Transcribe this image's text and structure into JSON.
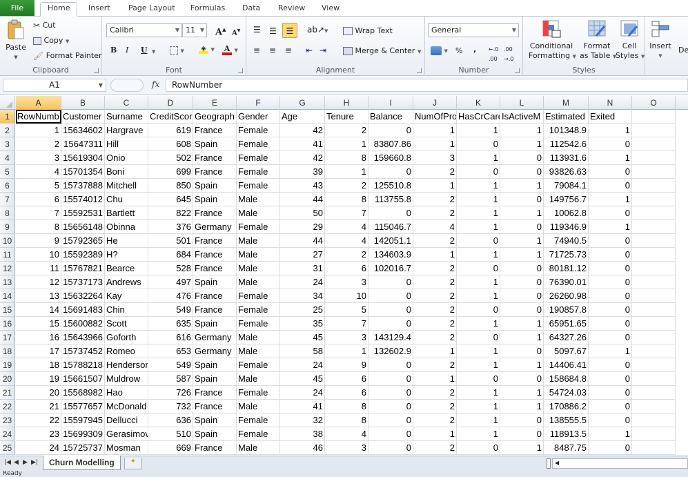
{
  "ribbon_tabs": [
    "File",
    "Home",
    "Insert",
    "Page Layout",
    "Formulas",
    "Data",
    "Review",
    "View"
  ],
  "active_tab": "Home",
  "clipboard": {
    "paste": "Paste",
    "cut": "Cut",
    "copy": "Copy",
    "format_painter": "Format Painter",
    "label": "Clipboard"
  },
  "font": {
    "name": "Calibri",
    "size": "11",
    "label": "Font",
    "bold": "B",
    "italic": "I",
    "underline": "U",
    "grow": "A",
    "shrink": "A"
  },
  "alignment": {
    "wrap_text": "Wrap Text",
    "merge_center": "Merge & Center",
    "label": "Alignment"
  },
  "number": {
    "format": "General",
    "percent": "%",
    "comma": ",",
    "inc_decimal": ".0→.00",
    "dec_decimal": ".00→.0",
    "label": "Number"
  },
  "styles": {
    "conditional": "Conditional",
    "conditional2": "Formatting",
    "format_table": "Format",
    "format_table2": "as Table",
    "cell_styles": "Cell",
    "cell_styles2": "Styles",
    "label": "Styles"
  },
  "cells": {
    "insert": "Insert",
    "delete": "De"
  },
  "formula_bar": {
    "name_box": "A1",
    "fx": "fx",
    "content": "RowNumber"
  },
  "columns": [
    "A",
    "B",
    "C",
    "D",
    "E",
    "F",
    "G",
    "H",
    "I",
    "J",
    "K",
    "L",
    "M",
    "N",
    "O"
  ],
  "header_row": [
    "RowNumber",
    "CustomerId",
    "Surname",
    "CreditScore",
    "Geography",
    "Gender",
    "Age",
    "Tenure",
    "Balance",
    "NumOfProducts",
    "HasCrCard",
    "IsActiveMember",
    "EstimatedSalary",
    "Exited",
    ""
  ],
  "header_display": [
    "RowNumb",
    "Customer",
    "Surname",
    "CreditScor",
    "Geograph",
    "Gender",
    "Age",
    "Tenure",
    "Balance",
    "NumOfPro",
    "HasCrCard",
    "IsActiveM",
    "Estimated",
    "Exited",
    ""
  ],
  "rows": [
    [
      "1",
      "15634602",
      "Hargrave",
      "619",
      "France",
      "Female",
      "42",
      "2",
      "0",
      "1",
      "1",
      "1",
      "101348.9",
      "1"
    ],
    [
      "2",
      "15647311",
      "Hill",
      "608",
      "Spain",
      "Female",
      "41",
      "1",
      "83807.86",
      "1",
      "0",
      "1",
      "112542.6",
      "0"
    ],
    [
      "3",
      "15619304",
      "Onio",
      "502",
      "France",
      "Female",
      "42",
      "8",
      "159660.8",
      "3",
      "1",
      "0",
      "113931.6",
      "1"
    ],
    [
      "4",
      "15701354",
      "Boni",
      "699",
      "France",
      "Female",
      "39",
      "1",
      "0",
      "2",
      "0",
      "0",
      "93826.63",
      "0"
    ],
    [
      "5",
      "15737888",
      "Mitchell",
      "850",
      "Spain",
      "Female",
      "43",
      "2",
      "125510.8",
      "1",
      "1",
      "1",
      "79084.1",
      "0"
    ],
    [
      "6",
      "15574012",
      "Chu",
      "645",
      "Spain",
      "Male",
      "44",
      "8",
      "113755.8",
      "2",
      "1",
      "0",
      "149756.7",
      "1"
    ],
    [
      "7",
      "15592531",
      "Bartlett",
      "822",
      "France",
      "Male",
      "50",
      "7",
      "0",
      "2",
      "1",
      "1",
      "10062.8",
      "0"
    ],
    [
      "8",
      "15656148",
      "Obinna",
      "376",
      "Germany",
      "Female",
      "29",
      "4",
      "115046.7",
      "4",
      "1",
      "0",
      "119346.9",
      "1"
    ],
    [
      "9",
      "15792365",
      "He",
      "501",
      "France",
      "Male",
      "44",
      "4",
      "142051.1",
      "2",
      "0",
      "1",
      "74940.5",
      "0"
    ],
    [
      "10",
      "15592389",
      "H?",
      "684",
      "France",
      "Male",
      "27",
      "2",
      "134603.9",
      "1",
      "1",
      "1",
      "71725.73",
      "0"
    ],
    [
      "11",
      "15767821",
      "Bearce",
      "528",
      "France",
      "Male",
      "31",
      "6",
      "102016.7",
      "2",
      "0",
      "0",
      "80181.12",
      "0"
    ],
    [
      "12",
      "15737173",
      "Andrews",
      "497",
      "Spain",
      "Male",
      "24",
      "3",
      "0",
      "2",
      "1",
      "0",
      "76390.01",
      "0"
    ],
    [
      "13",
      "15632264",
      "Kay",
      "476",
      "France",
      "Female",
      "34",
      "10",
      "0",
      "2",
      "1",
      "0",
      "26260.98",
      "0"
    ],
    [
      "14",
      "15691483",
      "Chin",
      "549",
      "France",
      "Female",
      "25",
      "5",
      "0",
      "2",
      "0",
      "0",
      "190857.8",
      "0"
    ],
    [
      "15",
      "15600882",
      "Scott",
      "635",
      "Spain",
      "Female",
      "35",
      "7",
      "0",
      "2",
      "1",
      "1",
      "65951.65",
      "0"
    ],
    [
      "16",
      "15643966",
      "Goforth",
      "616",
      "Germany",
      "Male",
      "45",
      "3",
      "143129.4",
      "2",
      "0",
      "1",
      "64327.26",
      "0"
    ],
    [
      "17",
      "15737452",
      "Romeo",
      "653",
      "Germany",
      "Male",
      "58",
      "1",
      "132602.9",
      "1",
      "1",
      "0",
      "5097.67",
      "1"
    ],
    [
      "18",
      "15788218",
      "Henderson",
      "549",
      "Spain",
      "Female",
      "24",
      "9",
      "0",
      "2",
      "1",
      "1",
      "14406.41",
      "0"
    ],
    [
      "19",
      "15661507",
      "Muldrow",
      "587",
      "Spain",
      "Male",
      "45",
      "6",
      "0",
      "1",
      "0",
      "0",
      "158684.8",
      "0"
    ],
    [
      "20",
      "15568982",
      "Hao",
      "726",
      "France",
      "Female",
      "24",
      "6",
      "0",
      "2",
      "1",
      "1",
      "54724.03",
      "0"
    ],
    [
      "21",
      "15577657",
      "McDonald",
      "732",
      "France",
      "Male",
      "41",
      "8",
      "0",
      "2",
      "1",
      "1",
      "170886.2",
      "0"
    ],
    [
      "22",
      "15597945",
      "Dellucci",
      "636",
      "Spain",
      "Female",
      "32",
      "8",
      "0",
      "2",
      "1",
      "0",
      "138555.5",
      "0"
    ],
    [
      "23",
      "15699309",
      "Gerasimov",
      "510",
      "Spain",
      "Female",
      "38",
      "4",
      "0",
      "1",
      "1",
      "0",
      "118913.5",
      "1"
    ],
    [
      "24",
      "15725737",
      "Mosman",
      "669",
      "France",
      "Male",
      "46",
      "3",
      "0",
      "2",
      "0",
      "1",
      "8487.75",
      "0"
    ]
  ],
  "sheet_tab": "Churn Modelling",
  "status": "Ready"
}
